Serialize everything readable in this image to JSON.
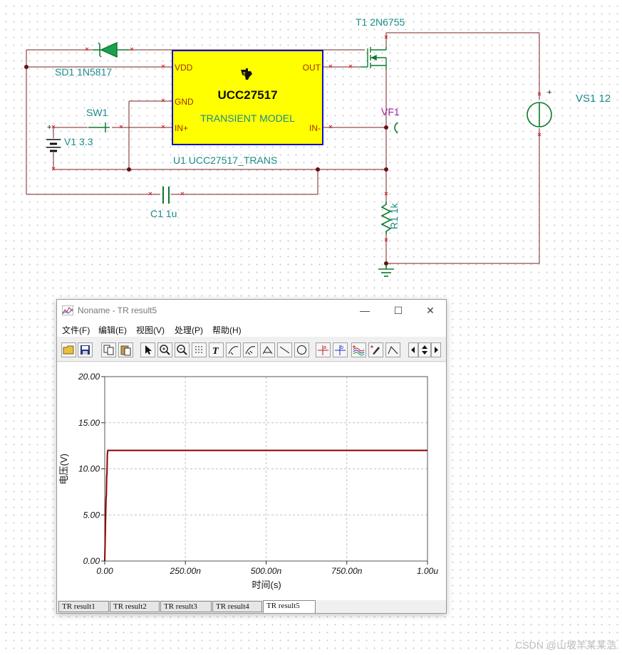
{
  "schematic": {
    "components": {
      "diode": "SD1 1N5817",
      "transistor": "T1 2N6755",
      "switch": "SW1",
      "battery": "V1 3.3",
      "ic": "U1 UCC27517_TRANS",
      "capacitor": "C1 1u",
      "probe": "VF1",
      "resistor": "R1 1k",
      "source": "VS1 12"
    },
    "ic": {
      "name": "UCC27517",
      "subtitle": "TRANSIENT MODEL",
      "pins": {
        "vdd": "VDD",
        "gnd": "GND",
        "in_plus": "IN+",
        "out": "OUT",
        "in_minus": "IN-"
      }
    },
    "polarity": {
      "plus": "+"
    }
  },
  "window": {
    "title": "Noname - TR result5",
    "controls": {
      "minimize": "—",
      "maximize": "☐",
      "close": "✕"
    },
    "menu": [
      "文件(F)",
      "编辑(E)",
      "视图(V)",
      "处理(P)",
      "帮助(H)"
    ],
    "toolbar_icons": [
      "open-icon",
      "save-icon",
      "copy-icon",
      "paste-icon",
      "pointer-icon",
      "zoom-in-icon",
      "zoom-out-icon",
      "grid-icon",
      "text-icon",
      "curve-icon",
      "curve2-icon",
      "curve3-icon",
      "line-icon",
      "circle-icon",
      "marker-a-icon",
      "marker-b-icon",
      "waves-icon",
      "pen-icon",
      "step-icon",
      "arrow-left-icon",
      "arrow-updown-icon",
      "arrow-right-icon"
    ],
    "tabs": [
      "TR result1",
      "TR result2",
      "TR result3",
      "TR result4",
      "TR result5"
    ],
    "active_tab": 4
  },
  "chart_data": {
    "type": "line",
    "title": "",
    "xlabel": "时间(s)",
    "ylabel": "电压(V)",
    "xlim": [
      0,
      1.0
    ],
    "ylim": [
      0,
      20
    ],
    "x_ticks": [
      "0.00",
      "250.00n",
      "500.00n",
      "750.00n",
      "1.00u"
    ],
    "y_ticks": [
      "0.00",
      "5.00",
      "10.00",
      "15.00",
      "20.00"
    ],
    "grid": true,
    "color": "#8b0000",
    "series": [
      {
        "x": [
          0,
          0.002,
          0.004,
          0.005,
          0.006,
          0.007,
          0.008,
          0.009,
          0.01,
          0.5,
          1.0
        ],
        "y": [
          0,
          3.5,
          6.8,
          7.2,
          9.2,
          9.5,
          11.5,
          11.9,
          12.0,
          12.0,
          12.0
        ]
      }
    ]
  },
  "watermark": "CSDN @山坡羊某某浩"
}
